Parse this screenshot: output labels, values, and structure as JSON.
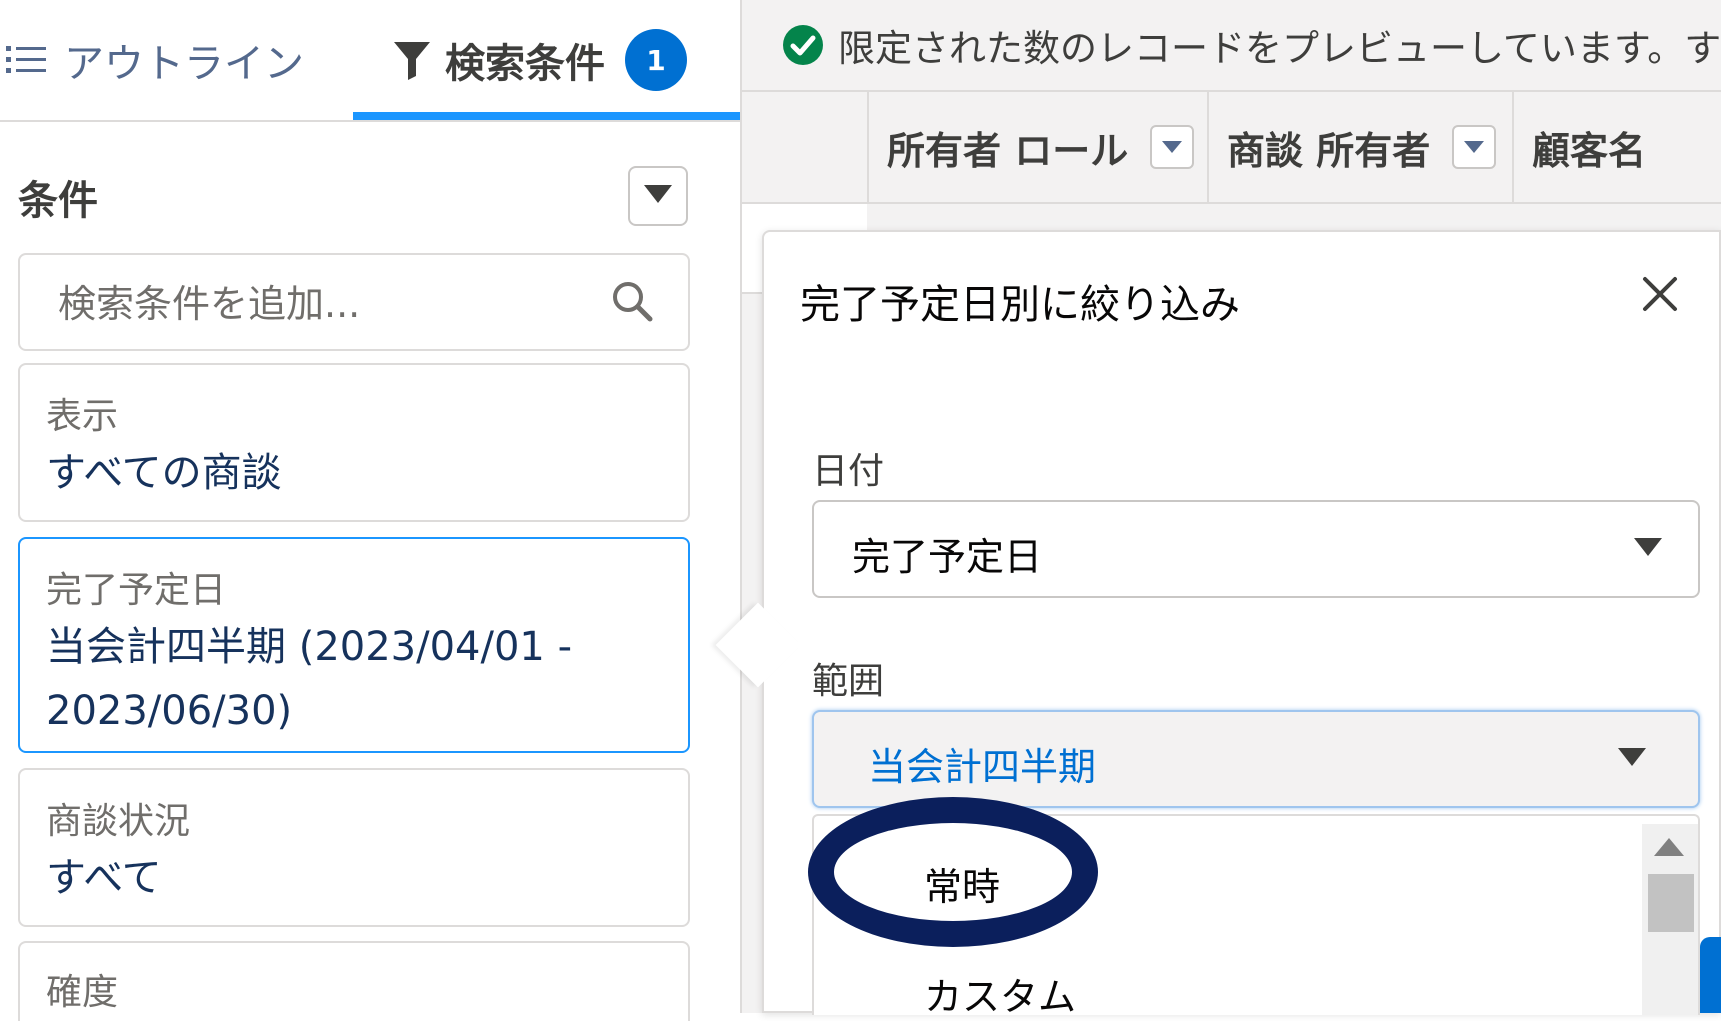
{
  "left_panel": {
    "tabs": {
      "outline_label": "アウトライン",
      "filters_label": "検索条件",
      "filters_badge": "1"
    },
    "conditions_title": "条件",
    "search": {
      "placeholder": "検索条件を追加..."
    },
    "filter_cards": [
      {
        "label": "表示",
        "value": "すべての商談"
      },
      {
        "label": "完了予定日",
        "value_line1": "当会計四半期 (2023/04/01 -",
        "value_line2": "2023/06/30)"
      },
      {
        "label": "商談状況",
        "value": "すべて"
      },
      {
        "label": "確度"
      }
    ]
  },
  "preview": {
    "banner_text": "限定された数のレコードをプレビューしています。す",
    "columns": [
      {
        "label": "所有者 ロール"
      },
      {
        "label": "商談 所有者"
      },
      {
        "label": "顧客名"
      }
    ]
  },
  "popover": {
    "title": "完了予定日別に絞り込み",
    "date_label": "日付",
    "date_value": "完了予定日",
    "range_label": "範囲",
    "range_value": "当会計四半期",
    "options": [
      "常時",
      "カスタム"
    ]
  },
  "colors": {
    "accent": "#0070d2",
    "active_tab": "#1b96ff",
    "success": "#04844b",
    "annotation": "#0b1f5c"
  },
  "icons": {
    "outline": "list-icon",
    "filters": "funnel-icon",
    "search": "search-icon",
    "banner": "check-circle-icon",
    "close": "close-icon",
    "dropdown": "chevron-down-icon"
  }
}
